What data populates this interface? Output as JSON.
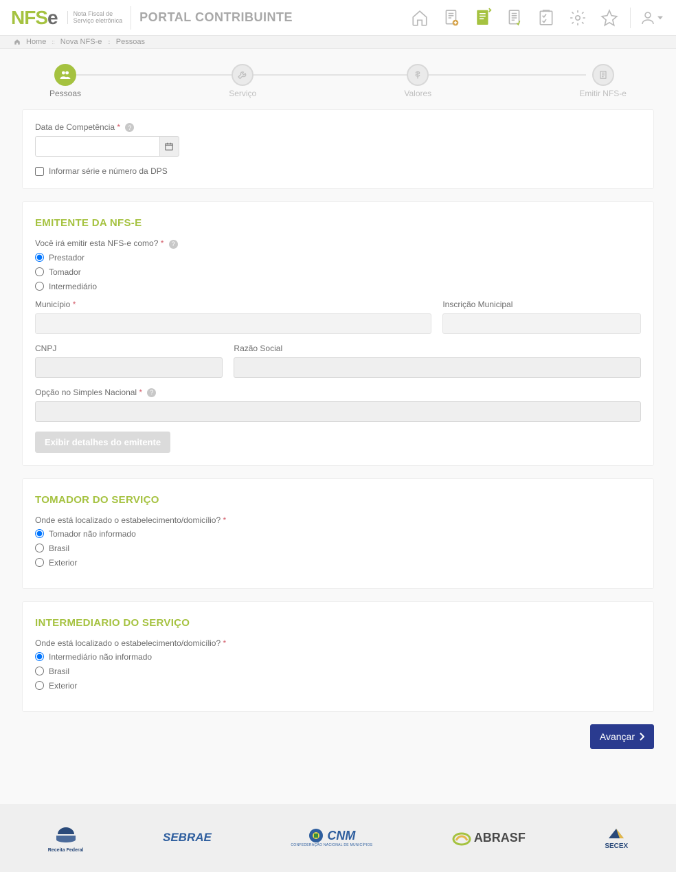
{
  "header": {
    "logo_sub_line1": "Nota Fiscal de",
    "logo_sub_line2": "Serviço eletrônica",
    "portal_title": "PORTAL CONTRIBUINTE"
  },
  "breadcrumb": {
    "items": [
      "Home",
      "Nova NFS-e",
      "Pessoas"
    ]
  },
  "stepper": {
    "steps": [
      {
        "label": "Pessoas"
      },
      {
        "label": "Serviço"
      },
      {
        "label": "Valores"
      },
      {
        "label": "Emitir NFS-e"
      }
    ]
  },
  "section_competencia": {
    "label": "Data de Competência",
    "checkbox": "Informar série e número da DPS"
  },
  "emitente": {
    "title": "EMITENTE DA NFS-E",
    "question": "Você irá emitir esta NFS-e como?",
    "options": [
      "Prestador",
      "Tomador",
      "Intermediário"
    ],
    "municipio_label": "Município",
    "inscricao_label": "Inscrição Municipal",
    "cnpj_label": "CNPJ",
    "razao_label": "Razão Social",
    "simples_label": "Opção no Simples Nacional",
    "detalhes_btn": "Exibir detalhes do emitente"
  },
  "tomador": {
    "title": "TOMADOR DO SERVIÇO",
    "question": "Onde está localizado o estabelecimento/domicílio?",
    "options": [
      "Tomador não informado",
      "Brasil",
      "Exterior"
    ]
  },
  "intermediario": {
    "title": "INTERMEDIARIO DO SERVIÇO",
    "question": "Onde está localizado o estabelecimento/domicílio?",
    "options": [
      "Intermediário não informado",
      "Brasil",
      "Exterior"
    ]
  },
  "actions": {
    "next": "Avançar"
  },
  "footer": {
    "logos": [
      "Receita Federal",
      "SEBRAE",
      "CNM",
      "ABRASF",
      "SECEX"
    ]
  }
}
